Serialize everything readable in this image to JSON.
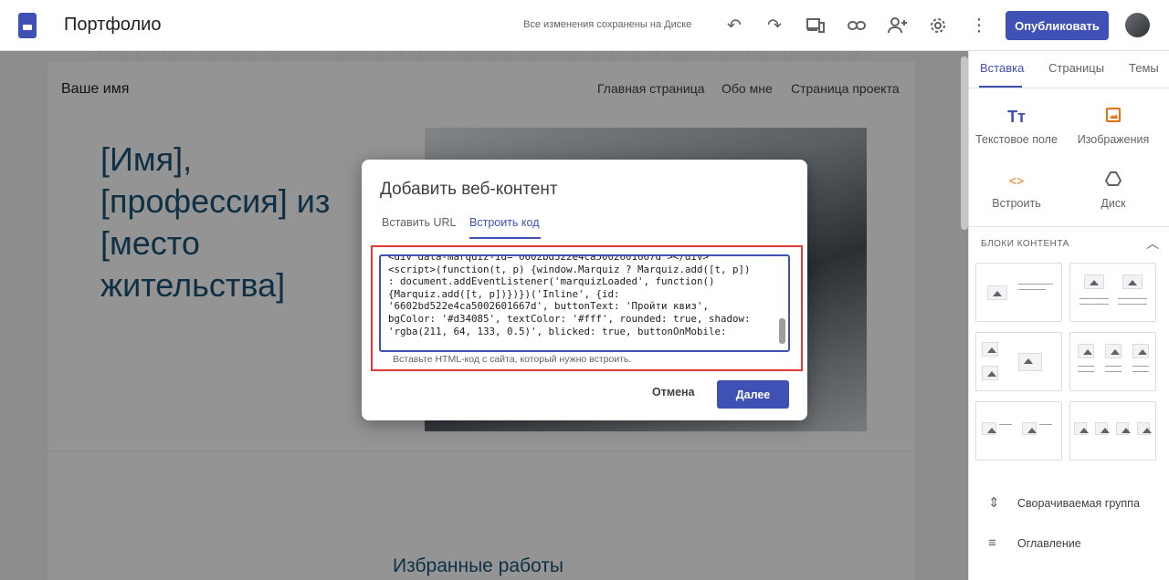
{
  "app": {
    "title": "Портфолио",
    "save_status": "Все изменения сохранены на Диске",
    "publish_label": "Опубликовать"
  },
  "site": {
    "name": "Ваше имя",
    "nav": [
      "Главная страница",
      "Обо мне",
      "Страница проекта"
    ],
    "hero_lines": [
      "[Имя],",
      "[профессия] из",
      "[место",
      "жительства]"
    ],
    "featured_title": "Избранные работы"
  },
  "right_panel": {
    "tabs": [
      "Вставка",
      "Страницы",
      "Темы"
    ],
    "insert_items": [
      {
        "label": "Текстовое поле",
        "icon": "text-box-icon"
      },
      {
        "label": "Изображения",
        "icon": "image-icon"
      },
      {
        "label": "Встроить",
        "icon": "embed-icon"
      },
      {
        "label": "Диск",
        "icon": "drive-icon"
      }
    ],
    "blocks_header": "БЛОКИ КОНТЕНТА",
    "actions": [
      {
        "label": "Сворачиваемая группа",
        "icon": "collapsible-group-icon"
      },
      {
        "label": "Оглавление",
        "icon": "table-of-contents-icon"
      }
    ]
  },
  "modal": {
    "title": "Добавить веб-контент",
    "tabs": [
      "Вставить URL",
      "Встроить код"
    ],
    "code": "<div data-marquiz-id=\"6602bd522e4ca5002601667d\"></div>\n<script>(function(t, p) {window.Marquiz ? Marquiz.add([t, p])\n: document.addEventListener('marquizLoaded', function()\n{Marquiz.add([t, p])})})('Inline', {id:\n'6602bd522e4ca5002601667d', buttonText: 'Пройти квиз',\nbgColor: '#d34085', textColor: '#fff', rounded: true, shadow:\n'rgba(211, 64, 133, 0.5)', blicked: true, buttonOnMobile:",
    "hint": "Вставьте HTML-код с сайта, который нужно встроить.",
    "cancel_label": "Отмена",
    "next_label": "Далее"
  },
  "colors": {
    "accent": "#3f51b5",
    "highlight_outline": "#e53935",
    "hero_text": "#1a5276"
  }
}
